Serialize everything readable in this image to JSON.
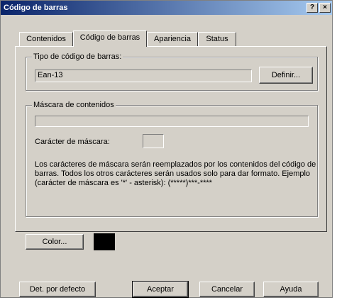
{
  "window": {
    "title": "Código de barras",
    "help_button": "?",
    "close_button": "×"
  },
  "tabs": [
    {
      "label": "Contenidos"
    },
    {
      "label": "Código de barras"
    },
    {
      "label": "Apariencia"
    },
    {
      "label": "Status"
    }
  ],
  "barcode_type": {
    "legend": "Tipo de código de barras:",
    "value": "Ean-13",
    "define_button": "Definir..."
  },
  "mask": {
    "legend": "Máscara de contenidos",
    "value": "",
    "char_label": "Carácter de máscara:",
    "char_value": "",
    "description": "Los carácteres de máscara serán reemplazados por los contenidos del código de barras. Todos los otros carácteres serán usados solo para dar formato. Ejemplo (carácter de máscara es '*' - asterisk): (*****)***-****"
  },
  "color": {
    "button_label": "Color...",
    "swatch_color": "#000000"
  },
  "footer": {
    "defaults_button": "Det. por defecto",
    "accept_button": "Aceptar",
    "cancel_button": "Cancelar",
    "help_button": "Ayuda"
  }
}
